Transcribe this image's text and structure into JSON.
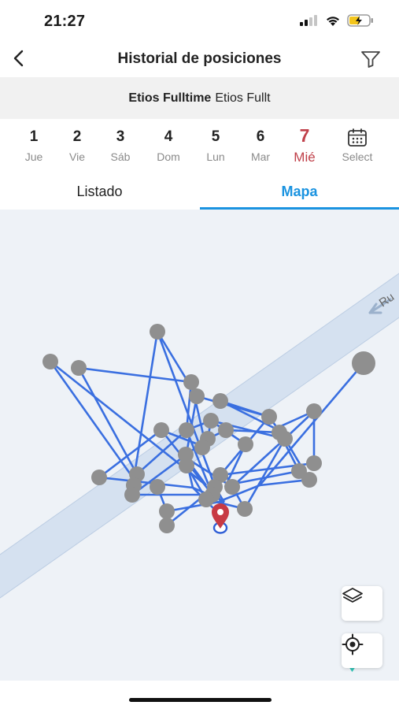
{
  "status_bar": {
    "time": "21:27",
    "icons": [
      "cellular-signal-icon",
      "wifi-icon",
      "battery-charging-icon"
    ]
  },
  "header": {
    "title": "Historial de posiciones",
    "back_icon": "chevron-left-icon",
    "filter_icon": "filter-icon"
  },
  "vehicle": {
    "name_bold": "Etios Fulltime",
    "name_regular": "Etios Fullt"
  },
  "days": [
    {
      "num": "1",
      "label": "Jue"
    },
    {
      "num": "2",
      "label": "Vie"
    },
    {
      "num": "3",
      "label": "Sáb"
    },
    {
      "num": "4",
      "label": "Dom"
    },
    {
      "num": "5",
      "label": "Lun"
    },
    {
      "num": "6",
      "label": "Mar"
    },
    {
      "num": "7",
      "label": "Mié",
      "active": true
    },
    {
      "num": "",
      "label": "Select",
      "icon": "calendar-icon"
    }
  ],
  "tabs": {
    "list_label": "Listado",
    "map_label": "Mapa",
    "active": "Mapa"
  },
  "map": {
    "road_label": "Ru",
    "controls": [
      "layers-icon",
      "locate-icon"
    ],
    "colors": {
      "route": "#3a6fe0",
      "point": "#8f8f8f",
      "marker": "#c83a44",
      "road": "#d5e1f0",
      "background": "#eef2f7"
    }
  }
}
